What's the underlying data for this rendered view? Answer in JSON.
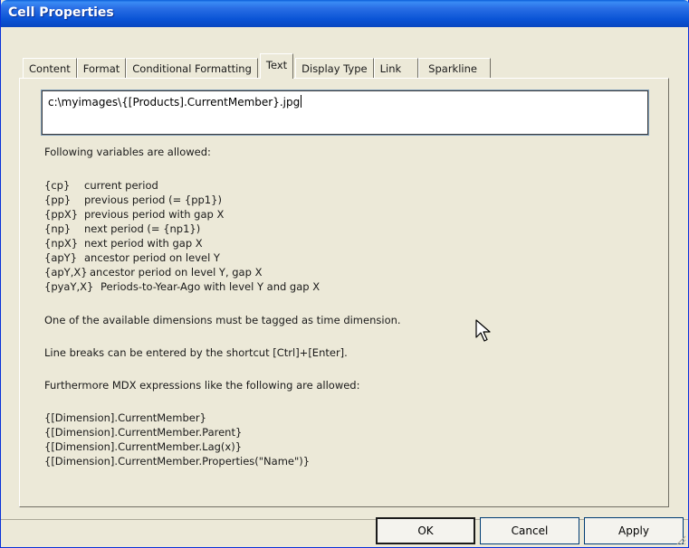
{
  "window": {
    "title": "Cell Properties"
  },
  "tabs": [
    {
      "label": "Content"
    },
    {
      "label": "Format"
    },
    {
      "label": "Conditional Formatting"
    },
    {
      "label": "Text"
    },
    {
      "label": "Display Type"
    },
    {
      "label": "Link"
    },
    {
      "label": "Sparkline"
    }
  ],
  "active_tab": "Text",
  "editor": {
    "value": "c:\\myimages\\{[Products].CurrentMember}.jpg"
  },
  "help": {
    "intro": "Following variables are allowed:",
    "variables": [
      {
        "name": "{cp}",
        "desc": "current period"
      },
      {
        "name": "{pp}",
        "desc": "previous period (= {pp1})"
      },
      {
        "name": "{ppX}",
        "desc": "previous period with gap X"
      },
      {
        "name": "{np}",
        "desc": "next period (= {np1})"
      },
      {
        "name": "{npX}",
        "desc": "next period with gap X"
      },
      {
        "name": "{apY}",
        "desc": "ancestor period on level Y"
      },
      {
        "name": "{apY,X}",
        "desc": "ancestor period on level Y, gap X"
      },
      {
        "name": "{pyaY,X}",
        "desc": "Periods-to-Year-Ago with level Y and gap X"
      }
    ],
    "time_note": "One of the available dimensions must be tagged as time dimension.",
    "linebreak_note": "Line breaks can be entered by the shortcut [Ctrl]+[Enter].",
    "mdx_intro": "Furthermore MDX expressions like the following are allowed:",
    "mdx_examples": [
      "{[Dimension].CurrentMember}",
      "{[Dimension].CurrentMember.Parent}",
      "{[Dimension].CurrentMember.Lag(x)}",
      "{[Dimension].CurrentMember.Properties(\"Name\")}"
    ]
  },
  "buttons": {
    "ok": "OK",
    "cancel": "Cancel",
    "apply": "Apply"
  },
  "colors": {
    "titlebar": "#0a54d6",
    "dialog_bg": "#ece9d8"
  },
  "icons": {
    "cursor": "mouse-pointer-icon",
    "resize": "size-grip-icon"
  }
}
